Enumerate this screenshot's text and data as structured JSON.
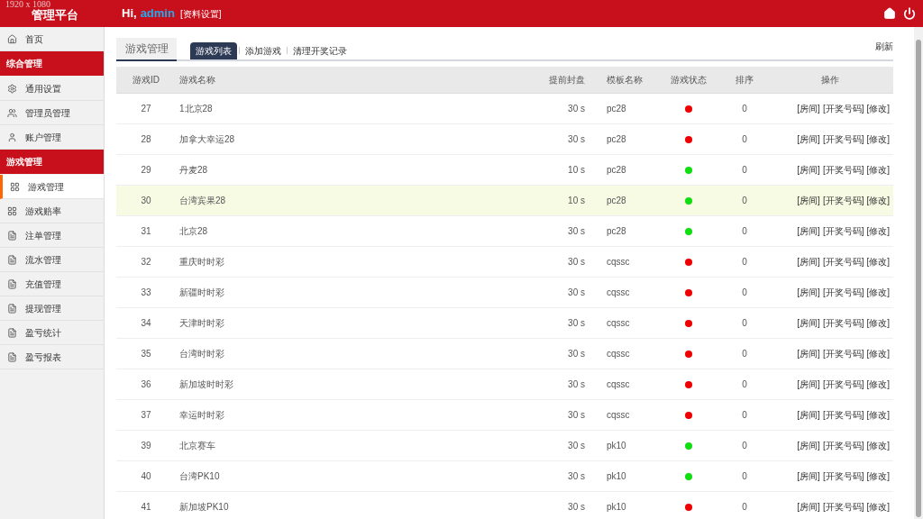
{
  "header": {
    "resolution": "1920 x 1080",
    "title": "管理平台",
    "greeting": "Hi,",
    "user": "admin",
    "profile_link": "[资料设置]"
  },
  "sidebar": {
    "items": [
      {
        "kind": "item",
        "label": "首页",
        "selected": false
      },
      {
        "kind": "section",
        "label": "综合管理"
      },
      {
        "kind": "item",
        "label": "通用设置",
        "selected": false
      },
      {
        "kind": "item",
        "label": "管理员管理",
        "selected": false
      },
      {
        "kind": "item",
        "label": "账户管理",
        "selected": false
      },
      {
        "kind": "section",
        "label": "游戏管理"
      },
      {
        "kind": "item",
        "label": "游戏管理",
        "selected": true
      },
      {
        "kind": "item",
        "label": "游戏赔率",
        "selected": false
      },
      {
        "kind": "item",
        "label": "注单管理",
        "selected": false
      },
      {
        "kind": "item",
        "label": "流水管理",
        "selected": false
      },
      {
        "kind": "item",
        "label": "充值管理",
        "selected": false
      },
      {
        "kind": "item",
        "label": "提现管理",
        "selected": false
      },
      {
        "kind": "item",
        "label": "盈亏统计",
        "selected": false
      },
      {
        "kind": "item",
        "label": "盈亏报表",
        "selected": false
      }
    ]
  },
  "page": {
    "title": "游戏管理",
    "tabs": [
      {
        "label": "游戏列表",
        "selected": true
      },
      {
        "label": "添加游戏",
        "selected": false
      },
      {
        "label": "清理开奖记录",
        "selected": false
      }
    ],
    "refresh": "刷新"
  },
  "table": {
    "columns": [
      "游戏ID",
      "游戏名称",
      "提前封盘",
      "模板名称",
      "游戏状态",
      "排序",
      "操作"
    ],
    "rows": [
      {
        "id": "27",
        "name": "1北京28",
        "close": "30 s",
        "template": "pc28",
        "color": "#ee0000",
        "sort": "0",
        "selected": false,
        "actions": [
          "[房间]",
          "[开奖号码]",
          "[修改]"
        ]
      },
      {
        "id": "28",
        "name": "加拿大幸运28",
        "close": "30 s",
        "template": "pc28",
        "color": "#ee0000",
        "sort": "0",
        "selected": false,
        "actions": [
          "[房间]",
          "[开奖号码]",
          "[修改]"
        ]
      },
      {
        "id": "29",
        "name": "丹麦28",
        "close": "10 s",
        "template": "pc28",
        "color": "#11dd11",
        "sort": "0",
        "selected": false,
        "actions": [
          "[房间]",
          "[开奖号码]",
          "[修改]"
        ]
      },
      {
        "id": "30",
        "name": "台湾宾果28",
        "close": "10 s",
        "template": "pc28",
        "color": "#11dd11",
        "sort": "0",
        "selected": true,
        "actions": [
          "[房间]",
          "[开奖号码]",
          "[修改]"
        ]
      },
      {
        "id": "31",
        "name": "北京28",
        "close": "30 s",
        "template": "pc28",
        "color": "#11dd11",
        "sort": "0",
        "selected": false,
        "actions": [
          "[房间]",
          "[开奖号码]",
          "[修改]"
        ]
      },
      {
        "id": "32",
        "name": "重庆时时彩",
        "close": "30 s",
        "template": "cqssc",
        "color": "#ee0000",
        "sort": "0",
        "selected": false,
        "actions": [
          "[房间]",
          "[开奖号码]",
          "[修改]"
        ]
      },
      {
        "id": "33",
        "name": "新疆时时彩",
        "close": "30 s",
        "template": "cqssc",
        "color": "#ee0000",
        "sort": "0",
        "selected": false,
        "actions": [
          "[房间]",
          "[开奖号码]",
          "[修改]"
        ]
      },
      {
        "id": "34",
        "name": "天津时时彩",
        "close": "30 s",
        "template": "cqssc",
        "color": "#ee0000",
        "sort": "0",
        "selected": false,
        "actions": [
          "[房间]",
          "[开奖号码]",
          "[修改]"
        ]
      },
      {
        "id": "35",
        "name": "台湾时时彩",
        "close": "30 s",
        "template": "cqssc",
        "color": "#ee0000",
        "sort": "0",
        "selected": false,
        "actions": [
          "[房间]",
          "[开奖号码]",
          "[修改]"
        ]
      },
      {
        "id": "36",
        "name": "新加坡时时彩",
        "close": "30 s",
        "template": "cqssc",
        "color": "#ee0000",
        "sort": "0",
        "selected": false,
        "actions": [
          "[房间]",
          "[开奖号码]",
          "[修改]"
        ]
      },
      {
        "id": "37",
        "name": "幸运时时彩",
        "close": "30 s",
        "template": "cqssc",
        "color": "#ee0000",
        "sort": "0",
        "selected": false,
        "actions": [
          "[房间]",
          "[开奖号码]",
          "[修改]"
        ]
      },
      {
        "id": "39",
        "name": "北京赛车",
        "close": "30 s",
        "template": "pk10",
        "color": "#11dd11",
        "sort": "0",
        "selected": false,
        "actions": [
          "[房间]",
          "[开奖号码]",
          "[修改]"
        ]
      },
      {
        "id": "40",
        "name": "台湾PK10",
        "close": "30 s",
        "template": "pk10",
        "color": "#11dd11",
        "sort": "0",
        "selected": false,
        "actions": [
          "[房间]",
          "[开奖号码]",
          "[修改]"
        ]
      },
      {
        "id": "41",
        "name": "新加坡PK10",
        "close": "30 s",
        "template": "pk10",
        "color": "#ee0000",
        "sort": "0",
        "selected": false,
        "actions": [
          "[房间]",
          "[开奖号码]",
          "[修改]"
        ]
      }
    ]
  }
}
